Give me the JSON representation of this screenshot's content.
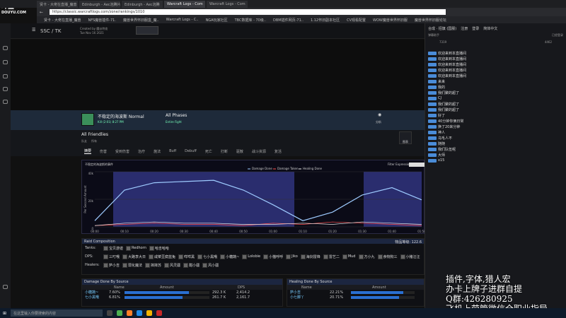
{
  "logo": {
    "text": "斗鱼",
    "sub": "DOUYU.COM"
  },
  "browser": {
    "tabs": [
      "贤卡 - 大佬在直播_魔兽",
      "Edinburgh - Aec泡腾片",
      "Edinburgh - Aec泡腾",
      "Warcraft Logs - Com",
      "Warcraft Logs - Com"
    ],
    "active_tab": 3,
    "url": "https://classic.warcraftlogs.com/zone/rankings/1010",
    "bookmarks": [
      "贤卡 - 大佬在直播_魔兽",
      "NFS魔兽插件-71.",
      "魔兽世界怀旧服盒_魔..",
      "Warcraft Logs - C..",
      "NGA玩家社区",
      "TBC数据库 - 70级..",
      "DBM插件网页-71..",
      "1.12怀旧副本社区",
      "CV观看配置",
      "WOW魔兽世界怀旧服",
      "魔兽世界怀旧服论坛"
    ]
  },
  "site": {
    "nav": "SSC / TK",
    "created_by": "Created by 魔派特攻",
    "date": "Tue Nov 16 2021",
    "right_label": "合成 · 招旗 (国服)",
    "login": "注册",
    "signup": "登录",
    "lang": "简体中文"
  },
  "fight": {
    "title": "不稳定的海波斯 Normal",
    "sub": "Kill (2:01)  8:27 PM",
    "phases": "All Phases",
    "phase_sub": "Entire Fight",
    "view_label": "分析",
    "table_label": "图表"
  },
  "friendlies": {
    "label": "All Friendlies",
    "sub1": "队友",
    "sub2": "所有"
  },
  "tabs": [
    "摘要",
    "伤害",
    "受到伤害",
    "治疗",
    "施法",
    "Buff",
    "Debuff",
    "死亡",
    "打断",
    "驱散",
    "战斗资源",
    "复活"
  ],
  "chart": {
    "dropdown": "不稳定的海波斯的事件",
    "filter_label": "Filter Expression",
    "legend": [
      "Damage Done",
      "Damage Taken",
      "Healing Done"
    ],
    "ylabel": "Per Second Amount",
    "yticks": [
      "40k",
      "20k",
      "0"
    ],
    "xticks": [
      "00:00",
      "00:10",
      "00:20",
      "00:30",
      "00:40",
      "00:50",
      "01:00",
      "01:10",
      "01:20",
      "01:30",
      "01:40",
      "01:50"
    ]
  },
  "chart_data": {
    "type": "line",
    "x": [
      "00:00",
      "00:10",
      "00:20",
      "00:30",
      "00:40",
      "00:50",
      "01:00",
      "01:10",
      "01:20",
      "01:30",
      "01:40",
      "01:50"
    ],
    "series": [
      {
        "name": "Damage Done",
        "values": [
          5,
          30,
          36,
          37,
          38,
          30,
          18,
          5,
          12,
          26,
          32,
          22
        ]
      },
      {
        "name": "Damage Taken",
        "values": [
          1,
          2,
          3,
          2,
          2,
          1,
          3,
          2,
          4,
          3,
          2,
          1
        ]
      },
      {
        "name": "Healing Done",
        "values": [
          1,
          3,
          4,
          3,
          3,
          2,
          2,
          3,
          2,
          4,
          3,
          2
        ]
      }
    ],
    "ylim": [
      0,
      45
    ]
  },
  "composition": {
    "title": "Raid Composition",
    "item_level": "物品等级: 122.6",
    "rows": [
      {
        "role": "Tanks:",
        "members": [
          "宝贝游迹",
          "Redhorn",
          "哈吉哈哈"
        ]
      },
      {
        "role": "DPS:",
        "members": [
          "三叮哦",
          "大路李大日",
          "咸菜豆腐蓝兔",
          "咩咩黑",
          "七小黑哦",
          "小糖蔬~",
          "Lolobie",
          "小猫呼呼",
          "Jiko",
          "海剑雷锋",
          "雷艺二",
          "Mud",
          "方小九",
          "食物狗三",
          "小猪汪汪"
        ]
      },
      {
        "role": "Healers:",
        "members": [
          "萨小吉",
          "弱化魔法",
          "摔摔苏",
          "风灵疆",
          "酣小疆",
          "风小疆"
        ]
      }
    ]
  },
  "damage": {
    "title": "Damage Done By Source",
    "cols": [
      "Name",
      "Amount",
      "DPS"
    ],
    "rows": [
      {
        "name": "小糖蔬~",
        "pct": "7.60%",
        "amount": "292.3 K",
        "dps": "2,414.2",
        "fill": 0.76
      },
      {
        "name": "七小黑哦",
        "pct": "6.81%",
        "amount": "261.7 K",
        "dps": "2,161.7",
        "fill": 0.68
      }
    ]
  },
  "healing": {
    "title": "Healing Done By Source",
    "cols": [
      "Name",
      "Amount"
    ],
    "rows": [
      {
        "name": "萨小吉",
        "pct": "22.21%",
        "fill": 0.82
      },
      {
        "name": "小七脚丫",
        "pct": "20.71%",
        "fill": 0.76
      }
    ]
  },
  "chat": {
    "label": "弹幕助手",
    "contrib_label": "已经登录",
    "count1": "7319",
    "count2": "4462",
    "lines": [
      "欢迎来到本直播间",
      "欢迎来到本直播间",
      "欢迎来到本直播间",
      "欢迎来到本直播间",
      "欢迎来到本直播间",
      "来来",
      "我的",
      "我们聚的超了",
      "CJ",
      "我们聚的超了",
      "我们聚的超了",
      "好了",
      "40分钟你俩日常",
      "换了20来分钟",
      "神人",
      "乌毛人不",
      "随随",
      "我们队伍呢",
      "大师",
      "x15"
    ]
  },
  "overlay": [
    "插件,字体,猎人宏",
    "办卡上牌子进群自提",
    "Q群:426280925",
    "飞机上劳管微信全职业指导"
  ],
  "taskbar": {
    "search": "在这里输入你要搜索的内容"
  }
}
